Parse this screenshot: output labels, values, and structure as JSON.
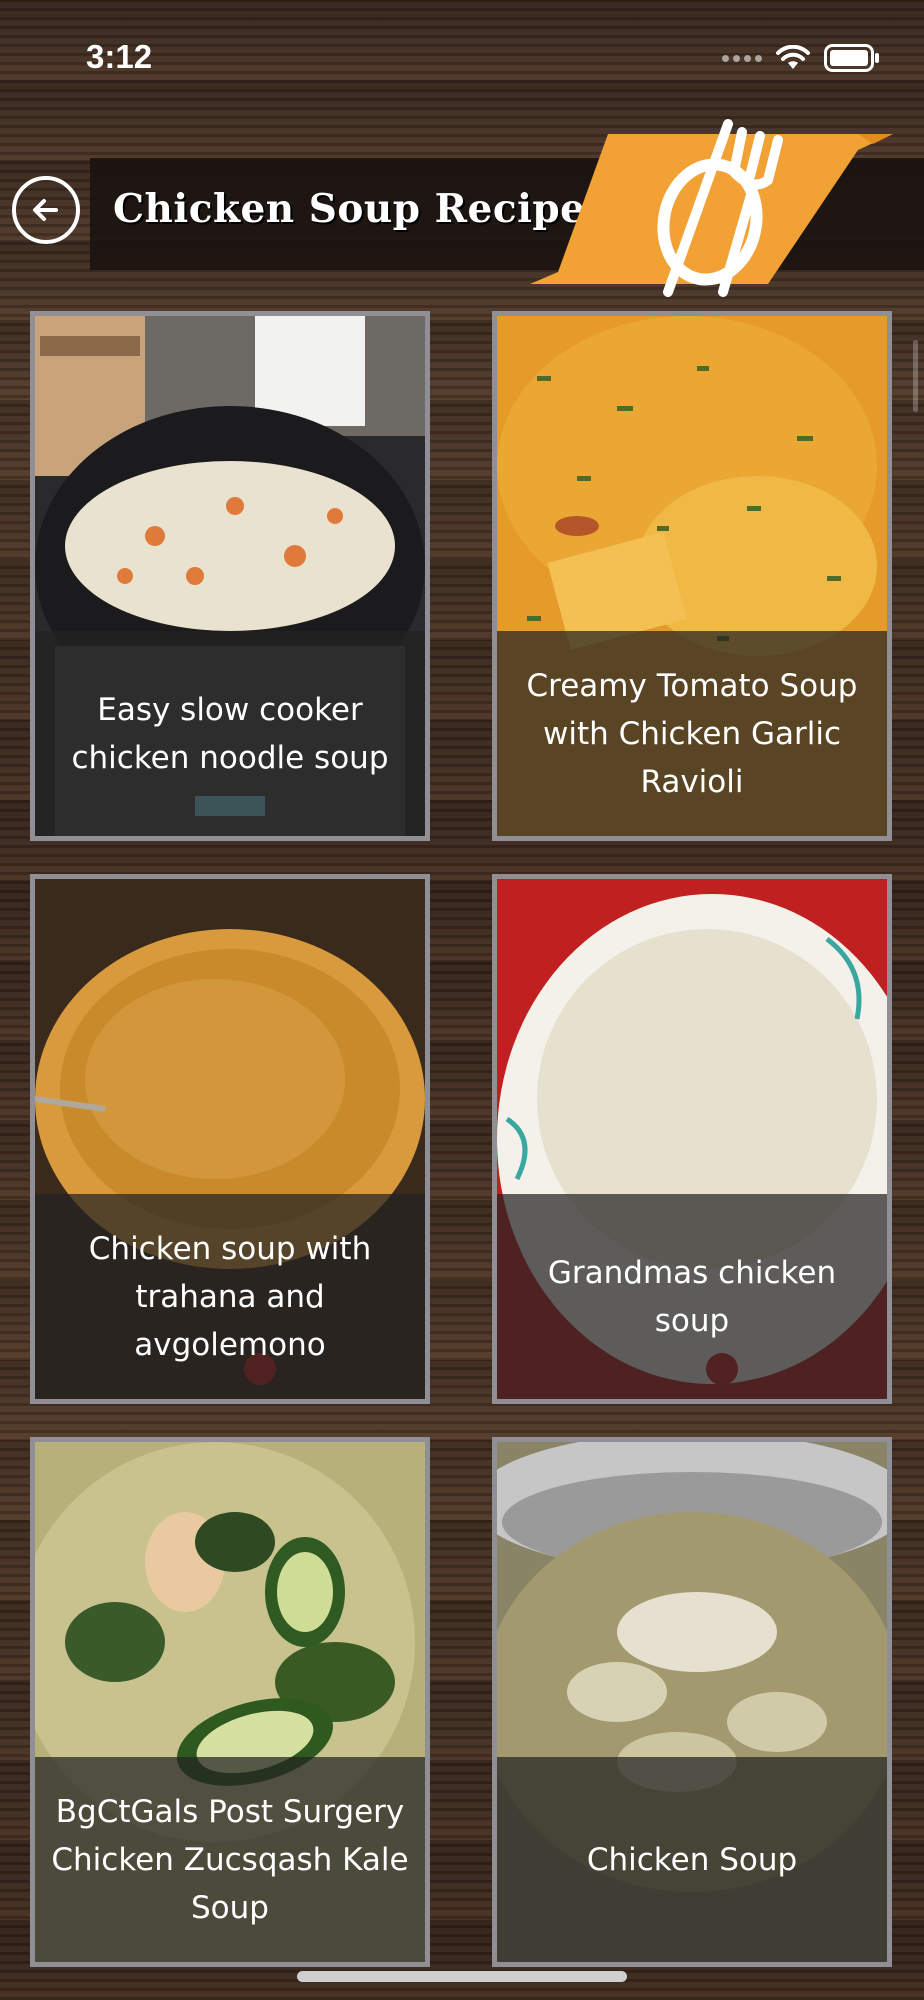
{
  "status_bar": {
    "time": "3:12"
  },
  "header": {
    "title": "Chicken Soup Recipes",
    "back_icon": "back-arrow-icon",
    "logo_icon": "fork-knife-logo-icon"
  },
  "colors": {
    "accent": "#f2a135",
    "card_border": "#8f8f95",
    "caption_bg": "#232323"
  },
  "recipes": [
    {
      "title": "Easy slow cooker chicken noodle soup",
      "photo": "slow-cooker-noodle-soup"
    },
    {
      "title": "Creamy Tomato Soup with Chicken  Garlic Ravioli",
      "photo": "creamy-tomato-ravioli-soup"
    },
    {
      "title": "Chicken soup with trahana and avgolemono",
      "photo": "trahana-soup-bowl"
    },
    {
      "title": "Grandmas chicken soup",
      "photo": "white-bowl-chicken-soup"
    },
    {
      "title": "BgCtGals Post Surgery Chicken Zucsqash Kale Soup",
      "photo": "zucchini-kale-soup"
    },
    {
      "title": "Chicken Soup",
      "photo": "pot-chicken-soup"
    }
  ]
}
